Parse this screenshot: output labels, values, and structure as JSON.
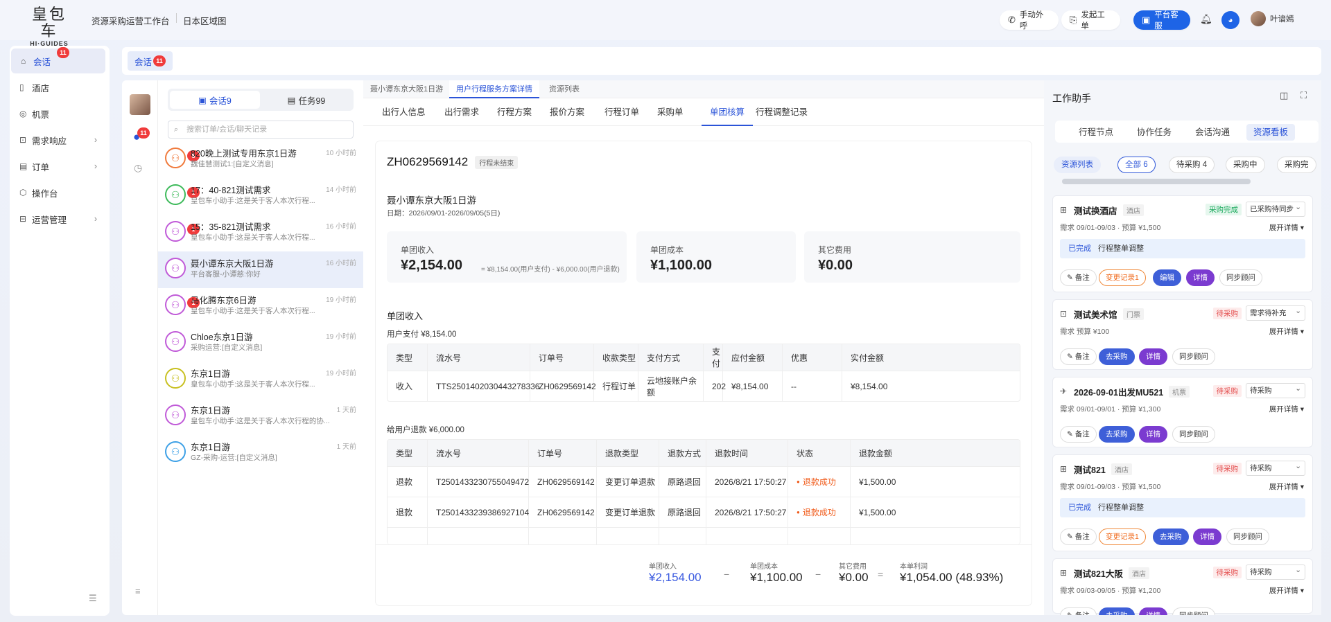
{
  "header": {
    "logo_cn": "皇包车",
    "logo_en": "HI·GUIDES",
    "crumbs": [
      "资源采购运营工作台",
      "日本区域图"
    ],
    "actions": {
      "call": "手动外呼",
      "ticket": "发起工单",
      "service": "平台客服",
      "user": "叶谙嫣"
    }
  },
  "nav": {
    "items": [
      {
        "label": "会话",
        "badge": "11"
      },
      {
        "label": "酒店"
      },
      {
        "label": "机票"
      },
      {
        "label": "需求响应"
      },
      {
        "label": "订单"
      },
      {
        "label": "操作台"
      },
      {
        "label": "运营管理"
      }
    ]
  },
  "tabstrip": {
    "label": "会话",
    "badge": "11"
  },
  "iconcol": {
    "badge": "11"
  },
  "chatlist": {
    "seg_chat": "会话9",
    "seg_task": "任务99",
    "search_placeholder": "搜索订单/会话/聊天记录",
    "items": [
      {
        "title": "820晚上测试专用东京1日游",
        "time": "10 小时前",
        "sub": "魏佳慧测试1:[自定义消息]",
        "badge": "8",
        "color": "#f07a3c"
      },
      {
        "title": "17：40-821测试需求",
        "time": "14 小时前",
        "sub": "皇包车小助手:这是关于客人本次行程...",
        "badge": "1",
        "color": "#3dba5a"
      },
      {
        "title": "15：35-821测试需求",
        "time": "16 小时前",
        "sub": "皇包车小助手:这是关于客人本次行程...",
        "badge": "1",
        "color": "#c05ad8"
      },
      {
        "title": "聂小谭东京大阪1日游",
        "time": "16 小时前",
        "sub": "平台客服-小谭慈:你好",
        "badge": "",
        "color": "#c05ad8"
      },
      {
        "title": "马化腾东京6日游",
        "time": "19 小时前",
        "sub": "皇包车小助手:这是关于客人本次行程...",
        "badge": "1",
        "color": "#c05ad8"
      },
      {
        "title": "Chloe东京1日游",
        "time": "19 小时前",
        "sub": "采购运营:[自定义消息]",
        "badge": "",
        "color": "#c05ad8"
      },
      {
        "title": "东京1日游",
        "time": "19 小时前",
        "sub": "皇包车小助手:这是关于客人本次行程...",
        "badge": "",
        "color": "#c8c020"
      },
      {
        "title": "东京1日游",
        "time": "1 天前",
        "sub": "皇包车小助手:这是关于客人本次行程的协...",
        "badge": "",
        "color": "#c05ad8"
      },
      {
        "title": "东京1日游",
        "time": "1 天前",
        "sub": "GZ-采购-运营:[自定义消息]",
        "badge": "",
        "color": "#3da0e6"
      }
    ]
  },
  "main": {
    "ptabs": [
      "聂小谭东京大阪1日游",
      "用户行程服务方案详情",
      "资源列表"
    ],
    "stabs": [
      "出行人信息",
      "出行需求",
      "行程方案",
      "报价方案",
      "行程订单",
      "采购单",
      "单团核算",
      "行程调整记录"
    ],
    "order_no": "ZH0629569142",
    "order_status": "行程未结束",
    "trip_title": "聂小谭东京大阪1日游",
    "trip_date": "日期：2026/09/01-2026/09/05(5日)",
    "summary": [
      {
        "label": "单团收入",
        "value": "¥2,154.00",
        "note": "= ¥8,154.00(用户支付) - ¥6,000.00(用户退款)"
      },
      {
        "label": "单团成本",
        "value": "¥1,100.00"
      },
      {
        "label": "其它费用",
        "value": "¥0.00"
      }
    ],
    "income_title": "单团收入",
    "pay_title": "用户支付 ¥8,154.00",
    "pay_headers": [
      "类型",
      "流水号",
      "订单号",
      "收款类型",
      "支付方式",
      "支付",
      "应付金额",
      "优惠",
      "实付金额"
    ],
    "pay_rows": [
      [
        "收入",
        "TTS2501402030443278336",
        "ZH0629569142",
        "行程订单",
        "云地接账户余额",
        "202",
        "¥8,154.00",
        "--",
        "¥8,154.00"
      ]
    ],
    "refund_title": "给用户退款 ¥6,000.00",
    "refund_headers": [
      "类型",
      "流水号",
      "订单号",
      "退款类型",
      "退款方式",
      "退款时间",
      "状态",
      "退款金额"
    ],
    "refund_rows": [
      [
        "退款",
        "T2501433230755049472",
        "ZH0629569142",
        "变更订单退款",
        "原路退回",
        "2026/8/21 17:50:27",
        "退款成功",
        "¥1,500.00"
      ],
      [
        "退款",
        "T2501433239386927104",
        "ZH0629569142",
        "变更订单退款",
        "原路退回",
        "2026/8/21 17:50:27",
        "退款成功",
        "¥1,500.00"
      ]
    ],
    "footer": {
      "income_label": "单团收入",
      "income": "¥2,154.00",
      "cost_label": "单团成本",
      "cost": "¥1,100.00",
      "other_label": "其它费用",
      "other": "¥0.00",
      "profit_label": "本单利润",
      "profit": "¥1,054.00 (48.93%)",
      "minus": "−",
      "equals": "="
    }
  },
  "rpanel": {
    "title": "工作助手",
    "tabs": [
      "行程节点",
      "协作任务",
      "会话沟通",
      "资源看板"
    ],
    "filters": [
      "资源列表",
      "全部 6",
      "待采购 4",
      "采购中",
      "采购完"
    ],
    "cards": [
      {
        "icon": "⊞",
        "title": "测试换酒店",
        "type": "酒店",
        "status": "采购完成",
        "select": "已采购待同步",
        "sub": "需求 09/01-09/03 · 预算 ¥1,500",
        "more": "展开详情 ▾",
        "note": "已完成",
        "note2": "行程整单调整",
        "buttons": [
          "备注",
          "变更记录1",
          "编辑",
          "详情",
          "同步顾问"
        ]
      },
      {
        "icon": "⊡",
        "title": "测试美术馆",
        "type": "门票",
        "status": "待采购",
        "select": "需求待补充",
        "sub": "需求 预算 ¥100",
        "more": "展开详情 ▾",
        "buttons": [
          "备注",
          "去采购",
          "详情",
          "同步顾问"
        ]
      },
      {
        "icon": "✈",
        "title": "2026-09-01出发MU521",
        "type": "机票",
        "status": "待采购",
        "select": "待采购",
        "sub": "需求 09/01-09/01 · 预算 ¥1,300",
        "more": "展开详情 ▾",
        "buttons": [
          "备注",
          "去采购",
          "详情",
          "同步顾问"
        ]
      },
      {
        "icon": "⊞",
        "title": "测试821",
        "type": "酒店",
        "status": "待采购",
        "select": "待采购",
        "sub": "需求 09/01-09/03 · 预算 ¥1,500",
        "more": "展开详情 ▾",
        "note": "已完成",
        "note2": "行程整单调整",
        "buttons": [
          "备注",
          "变更记录1",
          "去采购",
          "详情",
          "同步顾问"
        ]
      },
      {
        "icon": "⊞",
        "title": "测试821大阪",
        "type": "酒店",
        "status": "待采购",
        "select": "待采购",
        "sub": "需求 09/03-09/05 · 预算 ¥1,200",
        "more": "展开详情 ▾",
        "buttons": [
          "备注",
          "去采购",
          "详情",
          "同步顾问"
        ]
      }
    ]
  }
}
